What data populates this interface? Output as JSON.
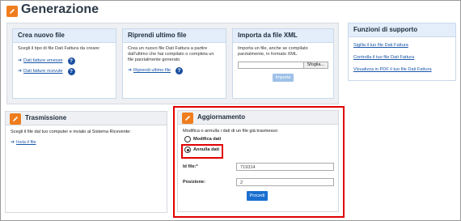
{
  "header": {
    "title": "Generazione"
  },
  "create": {
    "title": "Crea nuovo file",
    "description": "Scegli il tipo di file Dati Fattura da creare:",
    "links": [
      "Dati fatture emesse",
      "Dati fatture ricevute"
    ]
  },
  "resume": {
    "title": "Riprendi ultimo file",
    "description": "Crea un nuovo file Dati Fattura a partire dall'ultimo che hai compilato o completa un file parzialmente generato",
    "link": "Riprendi ultimo file"
  },
  "import": {
    "title": "Importa da file XML",
    "description": "Importa un file, anche se compilato parzialmente, in formato XML.",
    "file_button": "Sfoglia...",
    "submit_label": "Importa"
  },
  "support": {
    "title": "Funzioni di supporto",
    "links": [
      "Sigilla il tuo file Dati Fattura",
      "Controlla il tuo file Dati Fattura",
      "Visualizza in PDF il tuo file Dati Fattura"
    ]
  },
  "transmission": {
    "title": "Trasmissione",
    "description": "Scegli il file dal tuo computer e invialo al Sistema Ricevente:",
    "link": "Invia il file"
  },
  "update": {
    "title": "Aggiornamento",
    "description": "Modifica o annulla i dati di un file già trasmesso",
    "options": [
      "Modifica dati",
      "Annulla dati"
    ],
    "selected_option": "Annulla dati",
    "id_label": "Id file:*",
    "id_value": "719314",
    "position_label": "Posizione:",
    "position_value": "2",
    "submit_label": "Procedi"
  },
  "colors": {
    "accent_orange": "#f07d1d",
    "link_blue": "#1a55a8",
    "primary_button": "#1a6fd0",
    "highlight_red": "#e00000"
  }
}
